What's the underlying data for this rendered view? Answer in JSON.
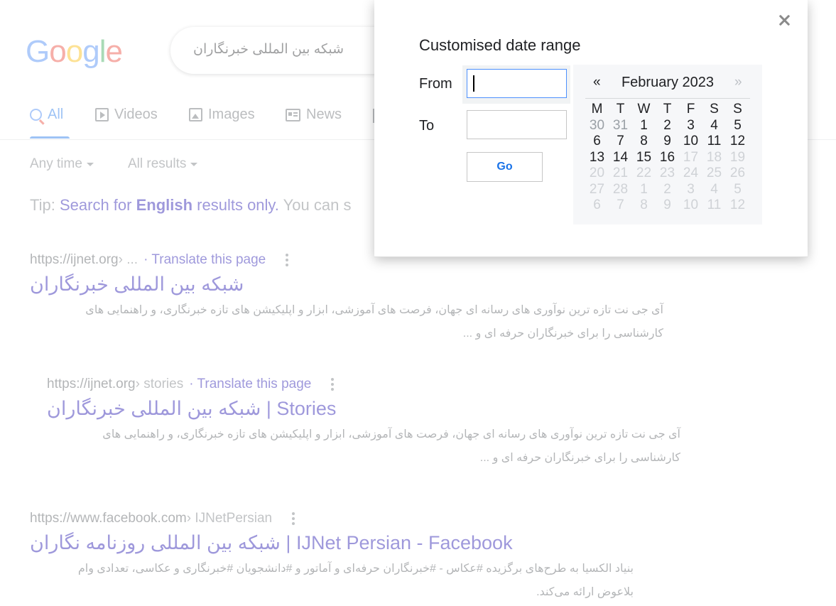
{
  "background": {
    "logo": [
      "G",
      "o",
      "o",
      "g",
      "l",
      "e"
    ],
    "search_query": "شبکه بین المللی خبرنگاران",
    "tabs": [
      {
        "label": "All",
        "icon": "search-icon"
      },
      {
        "label": "Videos",
        "icon": "video-icon"
      },
      {
        "label": "Images",
        "icon": "image-icon"
      },
      {
        "label": "News",
        "icon": "news-icon"
      }
    ],
    "tools": {
      "time": "Any time",
      "results": "All results"
    },
    "tip": {
      "prefix": "Tip: ",
      "link_start": "Search for ",
      "bold": "English",
      "link_end": " results only.",
      "suffix": " You can s"
    },
    "results": [
      {
        "url": "https://ijnet.org",
        "crumb": " › ... ",
        "translate": "· Translate this page",
        "title": "شبکه بین المللی خبرنگاران",
        "snippet_1": "آی جی نت تازه ترین نوآوری های رسانه ای جهان، فرصت های آموزشی، ابزار و اپلیکیشن های تازه خبرنگاری، و راهنمایی های",
        "snippet_2": "کارشناسی را برای خبرنگاران حرفه ای و ..."
      },
      {
        "url": "https://ijnet.org",
        "crumb": " › stories ",
        "translate": "· Translate this page",
        "title": "شبکه بین المللی خبرنگاران | Stories",
        "snippet_1": "آی جی نت تازه ترین نوآوری های رسانه ای جهان، فرصت های آموزشی، ابزار و اپلیکیشن های تازه خبرنگاری، و راهنمایی های",
        "snippet_2": "کارشناسی را برای خبرنگاران حرفه ای و ..."
      },
      {
        "url": "https://www.facebook.com",
        "crumb": " › IJNetPersian",
        "translate": "",
        "title": "شبکه بین المللی روزنامه نگاران | IJNet Persian - Facebook",
        "snippet_1": "بنیاد الکسیا به طرح‌های برگزیده #عکاس - #خبرنگاران حرفه‌ای و آماتور و #دانشجویان #خبرنگاری و عکاسی، تعدادی وام",
        "snippet_2": "بلاعوض ارائه می‌کند."
      }
    ]
  },
  "dialog": {
    "title": "Customised date range",
    "from_label": "From",
    "to_label": "To",
    "from_value": "",
    "to_value": "",
    "go_label": "Go",
    "close_glyph": "",
    "calendar": {
      "prev": "«",
      "next": "»",
      "month": "February 2023",
      "weekdays": [
        "M",
        "T",
        "W",
        "T",
        "F",
        "S",
        "S"
      ],
      "days": [
        {
          "d": "30",
          "s": "muted"
        },
        {
          "d": "31",
          "s": "muted"
        },
        {
          "d": "1",
          "s": "normal"
        },
        {
          "d": "2",
          "s": "normal"
        },
        {
          "d": "3",
          "s": "normal"
        },
        {
          "d": "4",
          "s": "normal"
        },
        {
          "d": "5",
          "s": "normal"
        },
        {
          "d": "6",
          "s": "normal"
        },
        {
          "d": "7",
          "s": "normal"
        },
        {
          "d": "8",
          "s": "normal"
        },
        {
          "d": "9",
          "s": "normal"
        },
        {
          "d": "10",
          "s": "normal"
        },
        {
          "d": "11",
          "s": "normal"
        },
        {
          "d": "12",
          "s": "normal"
        },
        {
          "d": "13",
          "s": "normal"
        },
        {
          "d": "14",
          "s": "normal"
        },
        {
          "d": "15",
          "s": "normal"
        },
        {
          "d": "16",
          "s": "normal"
        },
        {
          "d": "17",
          "s": "future"
        },
        {
          "d": "18",
          "s": "future"
        },
        {
          "d": "19",
          "s": "future"
        },
        {
          "d": "20",
          "s": "future"
        },
        {
          "d": "21",
          "s": "future"
        },
        {
          "d": "22",
          "s": "future"
        },
        {
          "d": "23",
          "s": "future"
        },
        {
          "d": "24",
          "s": "future"
        },
        {
          "d": "25",
          "s": "future"
        },
        {
          "d": "26",
          "s": "future"
        },
        {
          "d": "27",
          "s": "future"
        },
        {
          "d": "28",
          "s": "future"
        },
        {
          "d": "1",
          "s": "future"
        },
        {
          "d": "2",
          "s": "future"
        },
        {
          "d": "3",
          "s": "future"
        },
        {
          "d": "4",
          "s": "future"
        },
        {
          "d": "5",
          "s": "future"
        },
        {
          "d": "6",
          "s": "future"
        },
        {
          "d": "7",
          "s": "future"
        },
        {
          "d": "8",
          "s": "future"
        },
        {
          "d": "9",
          "s": "future"
        },
        {
          "d": "10",
          "s": "future"
        },
        {
          "d": "11",
          "s": "future"
        },
        {
          "d": "12",
          "s": "future"
        }
      ]
    }
  },
  "colors": {
    "accent": "#1a73e8",
    "link": "#1a0dab",
    "focus_border": "#4d90fe"
  }
}
